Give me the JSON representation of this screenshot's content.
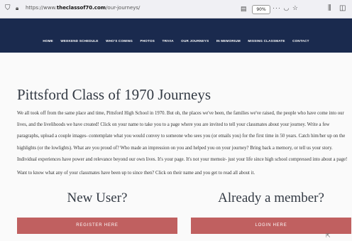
{
  "browser": {
    "url_prefix": "https://www.",
    "url_domain": "theclassof70.com",
    "url_path": "/our-journeys/",
    "zoom": "90%",
    "icons": [
      "shield-icon",
      "lock-icon",
      "reader-view-icon",
      "more-actions-icon",
      "pocket-icon",
      "bookmark-star-icon",
      "library-icon",
      "sidebar-icon"
    ]
  },
  "nav": {
    "items": [
      "HOME",
      "WEEKEND SCHEDULE",
      "WHO'S COMING",
      "PHOTOS",
      "TRIVIA",
      "OUR JOURNEYS",
      "IN MEMORIUM",
      "MISSING CLASSMATE",
      "CONTACT"
    ]
  },
  "main": {
    "title": "Pittsford Class of 1970 Journeys",
    "intro": "We all took off from the same place and time, Pittsford High School in 1970. But oh, the places we've been, the families we've raised, the people who have come into our lives, and the livelihoods we have created! Click on your name to take you to a page where you are invited to tell your classmates about your journey. Write a few paragraphs, upload a couple images- contemplate what you would convey to someone who sees you (or emails you) for the first time in 50 years. Catch him/her up on the highlights (or the lowlights). What are you proud of? Who made an impression on you and helped you on your journey? Bring back a memory, or tell us your story. Individual experiences have power and relevance beyond our own lives. It's your page. It's not your memoir- just your life since high school compressed into about a page!",
    "want_to_know": "Want to know what any of your classmates have been up to since then? Click on their name and you get to read all about it.",
    "new_user": {
      "heading": "New User?",
      "button": "REGISTER HERE"
    },
    "member": {
      "heading": "Already a member?",
      "button": "LOGIN HERE"
    }
  },
  "colors": {
    "nav_bg": "#1a2a4e",
    "button_bg": "#c06060"
  }
}
